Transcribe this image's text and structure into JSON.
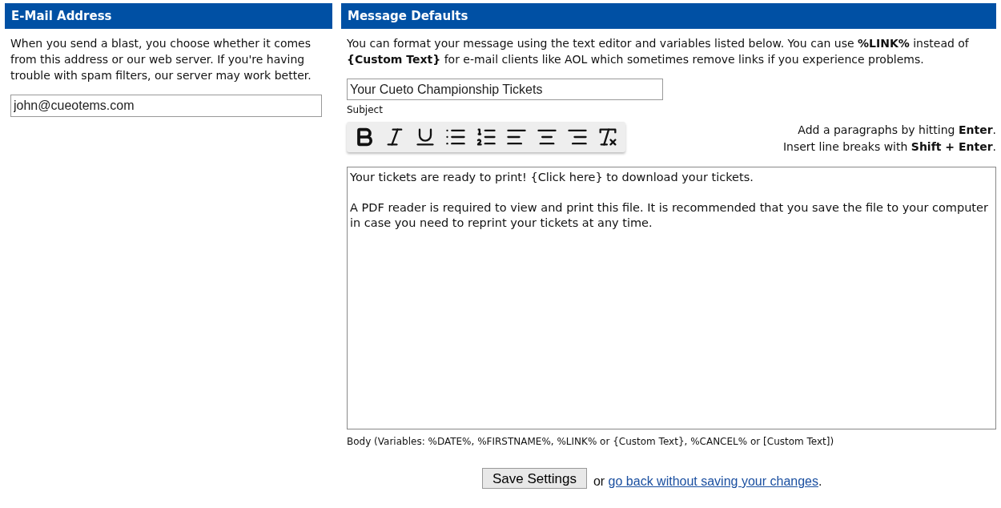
{
  "email_section": {
    "title": "E-Mail Address",
    "description": "When you send a blast, you choose whether it comes from this address or our web server. If you're having trouble with spam filters, our server may work better.",
    "email": {
      "value": "john@cueotems.com"
    }
  },
  "message_section": {
    "title": "Message Defaults",
    "description": "You can format your message using the text editor and variables listed below. You can use **%LINK%** instead of **{Custom Text}** for e-mail clients like AOL which sometimes remove links if you experience problems.",
    "subject": {
      "value": "Your Cueto Championship Tickets",
      "label": "Subject"
    },
    "toolbar": [
      {
        "kind": "bold"
      },
      {
        "kind": "italic"
      },
      {
        "kind": "underline"
      },
      {
        "kind": "bullets"
      },
      {
        "kind": "numbers"
      },
      {
        "kind": "align-left"
      },
      {
        "kind": "align-center"
      },
      {
        "kind": "align-right"
      },
      {
        "kind": "clear"
      }
    ],
    "hints": [
      "Add a paragraphs by hitting **Enter**.",
      "Insert line breaks with **Shift + Enter**."
    ],
    "body": {
      "paragraphs": [
        "Your tickets are ready to print! {Click here} to download your tickets.",
        "A PDF reader is required to view and print this file. It is recommended that you save the file to your computer in case you need to reprint your tickets at any time."
      ],
      "label": "Body (Variables: %DATE%, %FIRSTNAME%, %LINK% or {Custom Text}, %CANCEL% or [Custom Text])"
    }
  },
  "footer": {
    "button": "Save Settings",
    "or": "or",
    "link": "go back without saving your changes",
    "end": "."
  }
}
